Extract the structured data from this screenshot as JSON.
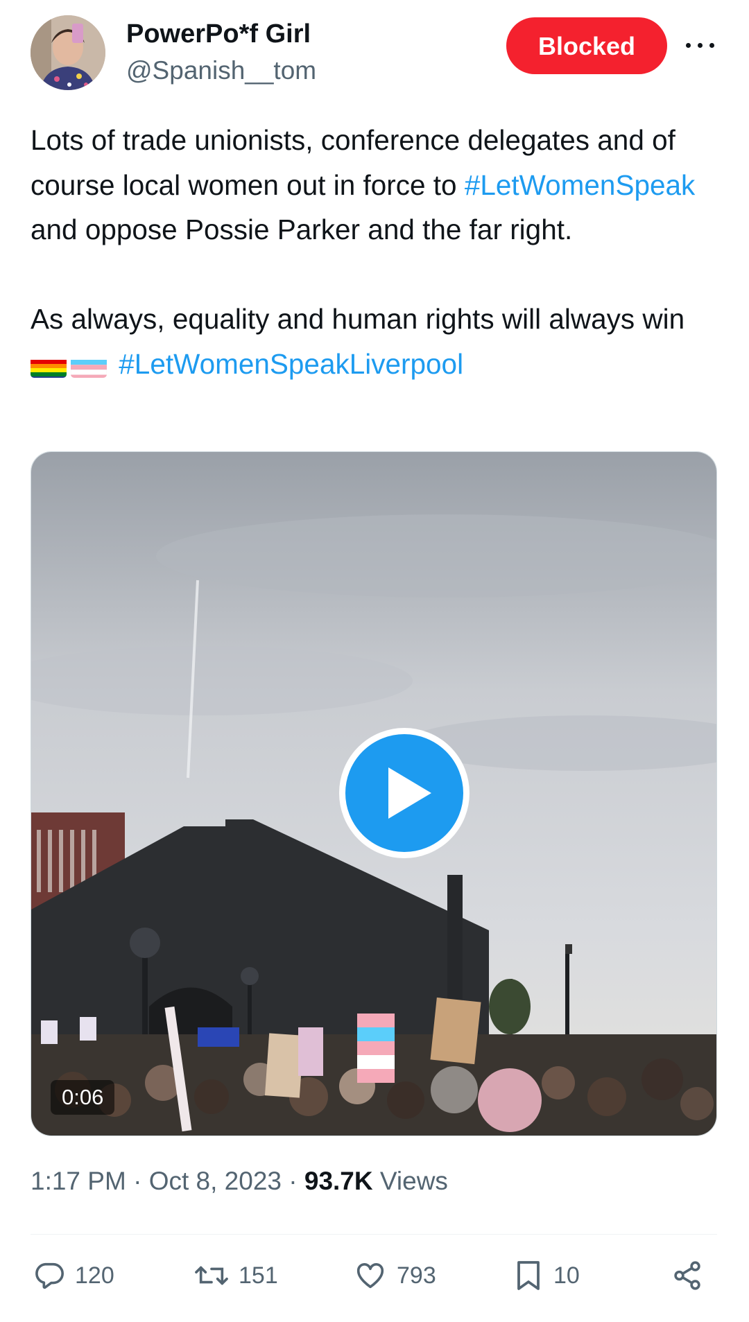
{
  "author": {
    "display_name": "PowerPo*f Girl",
    "handle": "@Spanish__tom",
    "avatar_icon": "person-avatar"
  },
  "header": {
    "blocked_label": "Blocked",
    "more_icon": "more-horizontal-icon"
  },
  "tweet": {
    "line1_text": "Lots of trade unionists, conference delegates and of course local women out in force to ",
    "line1_hashtag": "#LetWomenSpeak",
    "line1_tail": " and oppose Possie Parker and the far right.",
    "line2_text": "As always, equality and human rights will always win ",
    "line2_emojis": [
      "rainbow-flag",
      "transgender-flag"
    ],
    "line2_hashtag": "#LetWomenSpeakLiverpool"
  },
  "media": {
    "type": "video",
    "duration": "0:06",
    "play_icon": "play-icon"
  },
  "meta": {
    "time": "1:17 PM",
    "separator": "·",
    "date": "Oct 8, 2023",
    "views_count": "93.7K",
    "views_label": "Views"
  },
  "actions": {
    "replies": "120",
    "reposts": "151",
    "likes": "793",
    "bookmarks": "10"
  },
  "colors": {
    "accent": "#1d9bf0",
    "blocked": "#f4212e",
    "secondary_text": "#536471"
  }
}
